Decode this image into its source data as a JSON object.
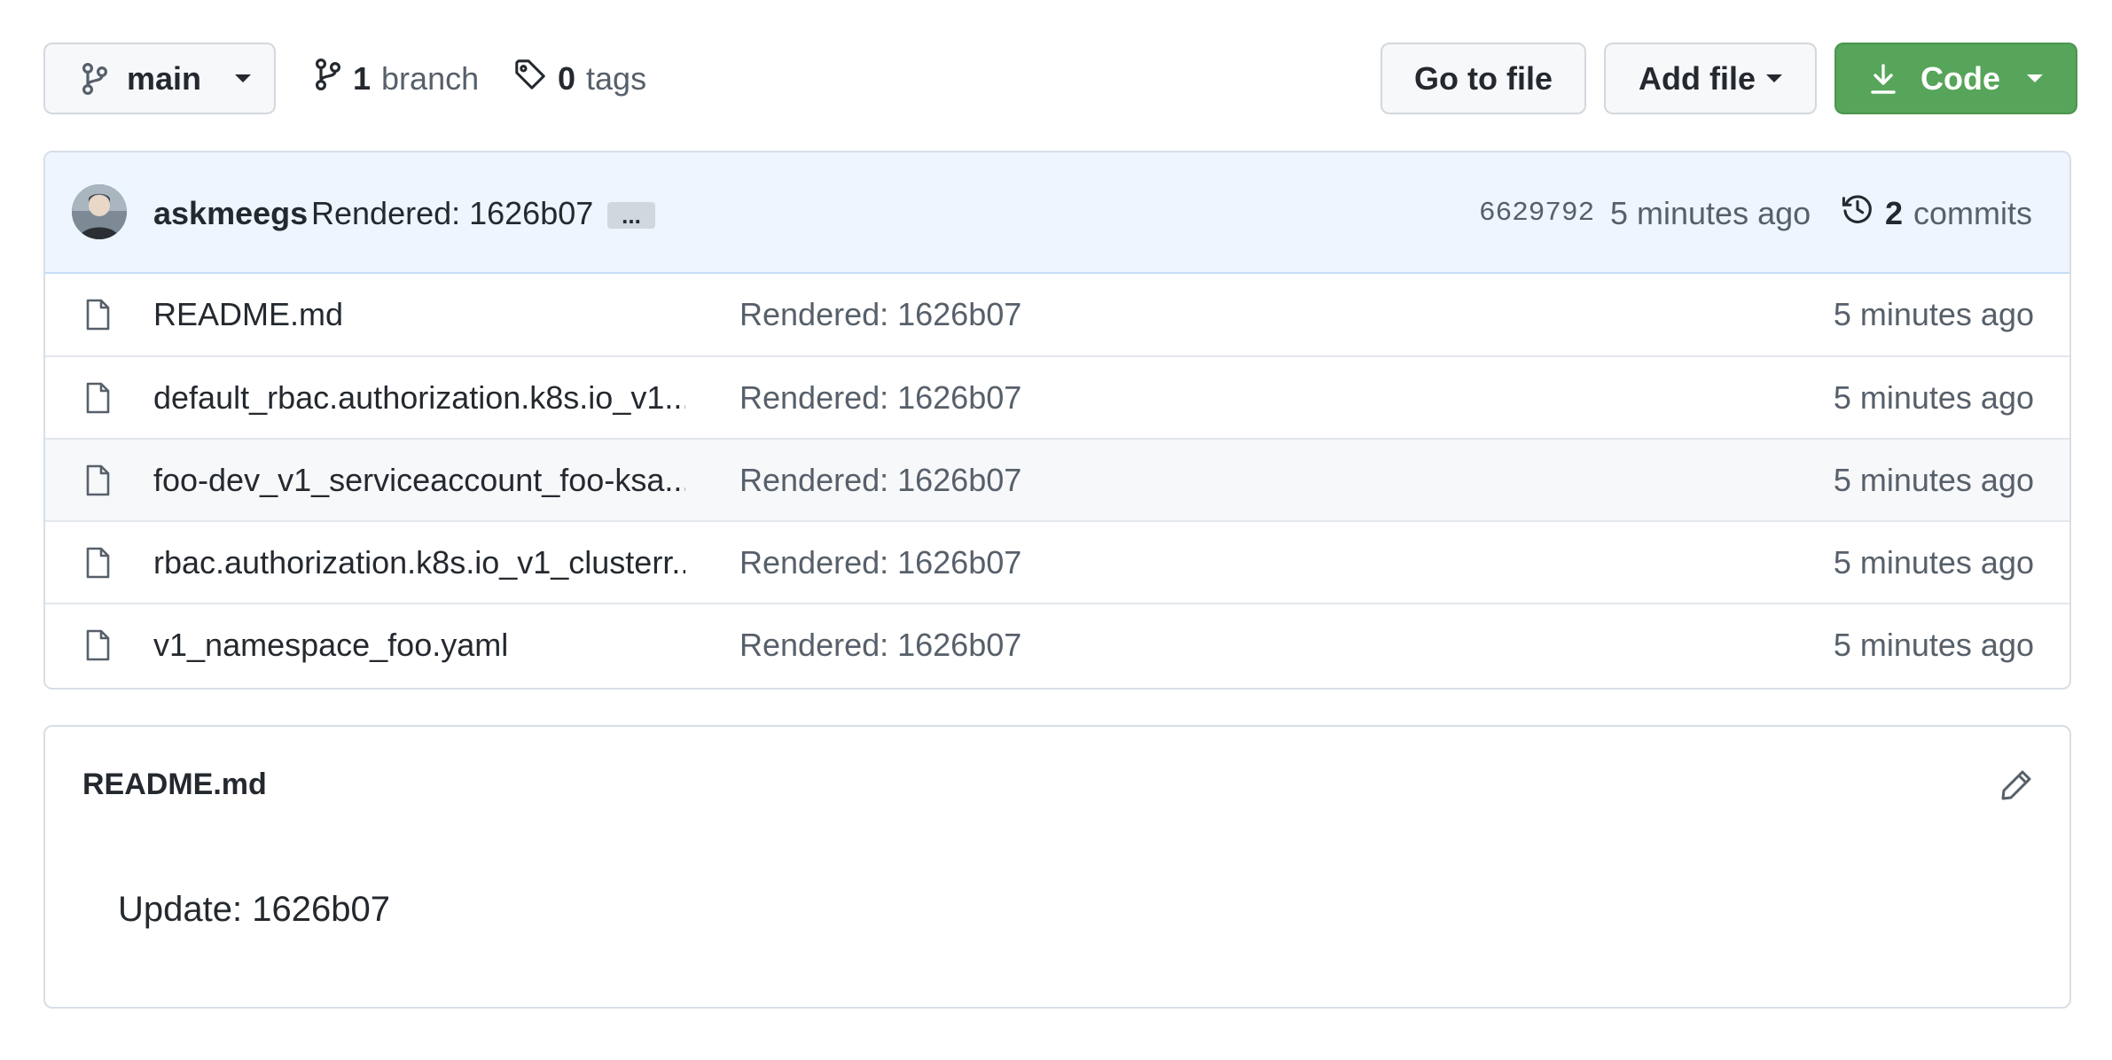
{
  "toolbar": {
    "branch_name": "main",
    "branches_count": "1",
    "branches_label": "branch",
    "tags_count": "0",
    "tags_label": "tags",
    "goto_file_label": "Go to file",
    "add_file_label": "Add file",
    "code_label": "Code"
  },
  "latest_commit": {
    "author": "askmeegs",
    "message": "Rendered: 1626b07",
    "ellipsis": "...",
    "sha": "6629792",
    "time": "5 minutes ago",
    "commits_count": "2",
    "commits_label": "commits"
  },
  "files": [
    {
      "name": "README.md",
      "message": "Rendered: 1626b07",
      "time": "5 minutes ago"
    },
    {
      "name": "default_rbac.authorization.k8s.io_v1...",
      "message": "Rendered: 1626b07",
      "time": "5 minutes ago"
    },
    {
      "name": "foo-dev_v1_serviceaccount_foo-ksa...",
      "message": "Rendered: 1626b07",
      "time": "5 minutes ago"
    },
    {
      "name": "rbac.authorization.k8s.io_v1_clusterr...",
      "message": "Rendered: 1626b07",
      "time": "5 minutes ago"
    },
    {
      "name": "v1_namespace_foo.yaml",
      "message": "Rendered: 1626b07",
      "time": "5 minutes ago"
    }
  ],
  "readme": {
    "title": "README.md",
    "body": "Update: 1626b07"
  },
  "colors": {
    "code_button": "#57a55a",
    "commit_bar": "#eef5ff",
    "muted_text": "#57606a"
  },
  "icons": {
    "branch": "git-branch-icon",
    "tag": "tag-icon",
    "download": "download-icon",
    "history": "history-icon",
    "file": "file-icon",
    "edit": "pencil-icon"
  }
}
